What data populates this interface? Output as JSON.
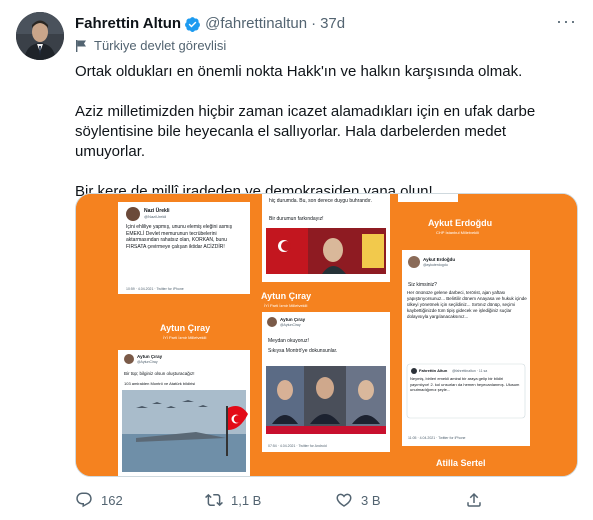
{
  "tweet": {
    "name": "Fahrettin Altun",
    "handle": "@fahrettinaltun",
    "separator": "·",
    "time": "37d",
    "label": "Türkiye devlet görevlisi",
    "paragraphs": [
      "Ortak oldukları en önemli nokta Hakk'ın ve halkın karşısında olmak.",
      "Aziz milletimizden hiçbir zaman icazet alamadıkları için en ufak darbe söylentisine bile heyecanla el sallıyorlar. Hala darbelerden medet umuyorlar.",
      "Bir kere de millî iradeden ve demokrasiden yana olun!"
    ]
  },
  "media": {
    "collage": {
      "left_tweet": {
        "name": "Nazi Ürekli",
        "handle": "@NaziUrekli",
        "body": "İçini ehliliye yapmış, ununu elemiş eleğini asmış EMEKLİ Devlet memurunun tecrübelerini aktarmasından rahatsız olan, KORKAN, bunu FIRSATA çevirmeye çalışan iktidar ACİZDİR!",
        "footer": "10:59 · 4.04.2021 · Twitter for iPhone"
      },
      "labels": {
        "aytun_left_name": "Aytun Çıray",
        "aytun_left_sub": "İYİ Parti İzmir Milletvekili",
        "aytun_mid_name": "Aytun Çıray",
        "aytun_mid_sub": "İYİ Parti İzmir Milletvekili",
        "aykut_name": "Aykut Erdoğdu",
        "aykut_sub": "CHP İstanbul Milletvekili",
        "atilla": "Atilla Sertel"
      },
      "top_mid_text": "hiç durumda. Bu, son derece duygu buhrandır.",
      "top_mid_text2": "Bir durumun farkındayız!",
      "mid_tweet": {
        "name": "Aytun Çıray",
        "handle": "@AytunCiray",
        "body1": "Meydan okuyoruz!",
        "body2": "Sıkıysa Montrö'ye dokunsunlar.",
        "footer": "07:54 · 4.04.2021 · Twitter for Android"
      },
      "bottom_left_tweet": {
        "name": "Aytun Çıray",
        "handle": "@AytunCiray",
        "body": "Bir tüp; bilginiz olsun oluşturacağız!",
        "quote": "103 amiralden Montrö ve Atatürk bildirisi"
      },
      "aykut_tweet": {
        "name": "Aykut Erdoğdu",
        "handle": "@aykuterdogdu",
        "q": "Siz kimsiniz?",
        "body": "Her önünüze gelene darbeci, terörist, ajan yaftası yapıştırıyorsunuz... Belirtilir dönem Anayasa ve hukuk içinde ülkeyi yönetmek için seçildiniz... Sırtınız dönüp, seçimi kaybettiğinizde tüm tipiş gidecek ve işlediğiniz suçlar dolayısıyla yargılanacaksınız...",
        "quote_name": "Fahrettin Altun",
        "quote_handle": "@fahrettinaltun · 11 sa",
        "quote_body": "Neymiş, birileri emekli amiral bir araya gelip bir bildiri yayımlıyor! 2. kol unsurları da hemen heyecanlanmış. Ulusum unutmadığımız şeyle...",
        "footer": "11:05 · 4.04.2021 · Twitter for iPhone"
      }
    }
  },
  "actions": {
    "replies": "162",
    "retweets": "1,1 B",
    "likes": "3 B"
  },
  "colors": {
    "accent": "#1d9bf0",
    "collage_orange": "#f5821f",
    "secondary_text": "#536471"
  }
}
